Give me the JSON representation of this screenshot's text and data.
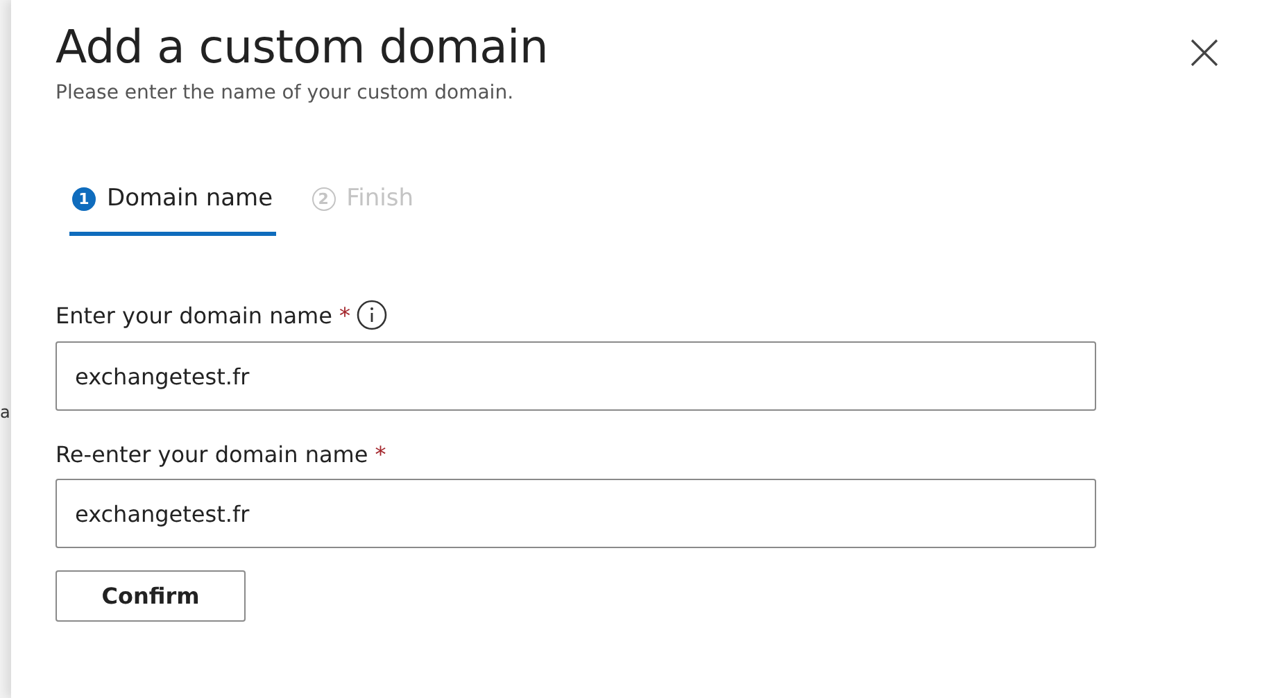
{
  "background_fragment": "a",
  "panel": {
    "title": "Add a custom domain",
    "subtitle": "Please enter the name of your custom domain."
  },
  "steps": [
    {
      "number": "1",
      "label": "Domain name",
      "selected": true
    },
    {
      "number": "2",
      "label": "Finish",
      "selected": false
    }
  ],
  "fields": [
    {
      "label": "Enter your domain name",
      "required": "*",
      "info": true,
      "value": "exchangetest.fr"
    },
    {
      "label": "Re-enter your domain name",
      "required": "*",
      "info": false,
      "value": "exchangetest.fr"
    }
  ],
  "button": "Confirm"
}
